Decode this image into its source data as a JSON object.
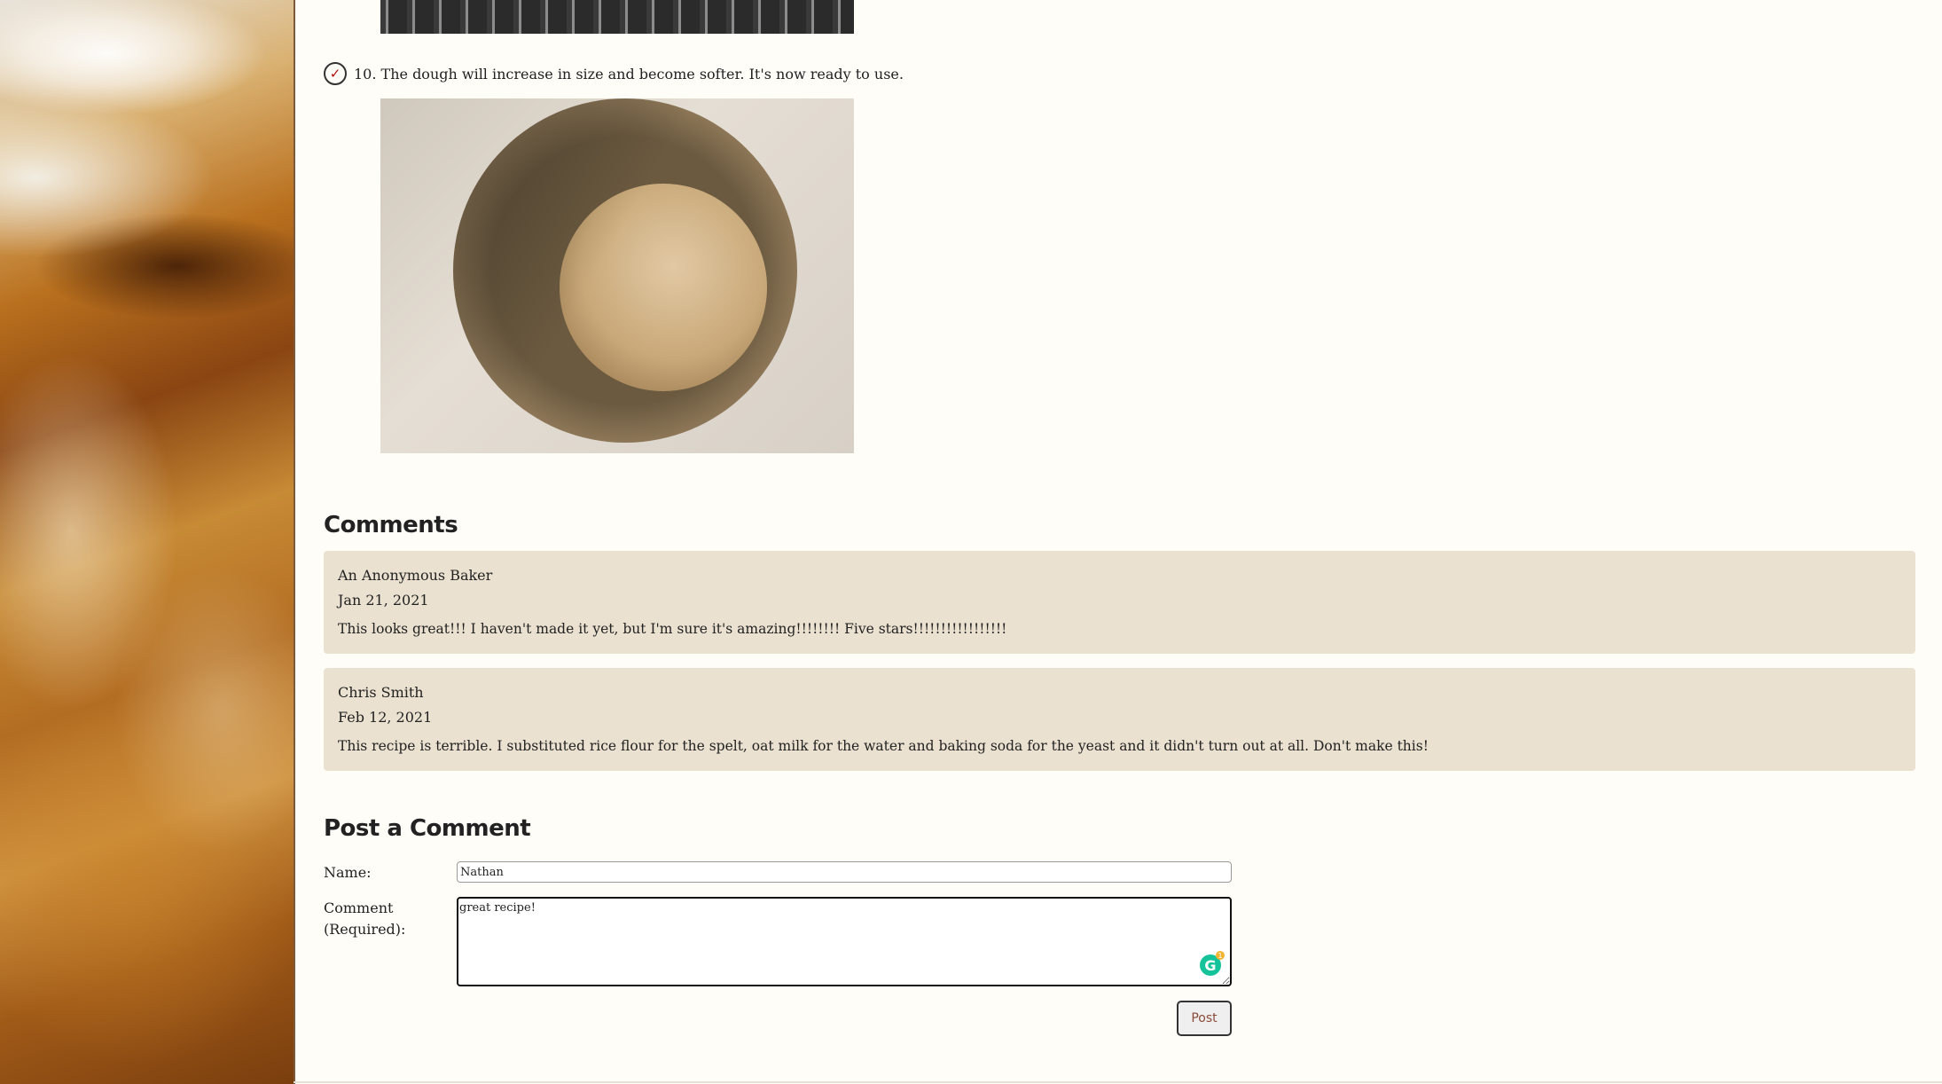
{
  "step": {
    "text": "10. The dough will increase in size and become softer. It's now ready to use.",
    "check_glyph": "✓"
  },
  "comments_section": {
    "title": "Comments",
    "items": [
      {
        "author": "An Anonymous Baker",
        "date": "Jan 21, 2021",
        "body": "This looks great!!! I haven't made it yet, but I'm sure it's amazing!!!!!!!! Five stars!!!!!!!!!!!!!!!!!"
      },
      {
        "author": "Chris Smith",
        "date": "Feb 12, 2021",
        "body": "This recipe is terrible. I substituted rice flour for the spelt, oat milk for the water and baking soda for the yeast and it didn't turn out at all. Don't make this!"
      }
    ]
  },
  "post_form": {
    "title": "Post a Comment",
    "name_label": "Name:",
    "name_value": "Nathan",
    "comment_label": "Comment (Required):",
    "comment_value": "great recipe!",
    "post_button": "Post",
    "grammarly_glyph": "G",
    "grammarly_count": "1"
  },
  "icons": {
    "check": "check-circle-icon",
    "grammarly": "grammarly-icon"
  },
  "colors": {
    "page_background": "#fffdf8",
    "comment_background": "#ebe1d0",
    "grammarly": "#15c39a"
  }
}
